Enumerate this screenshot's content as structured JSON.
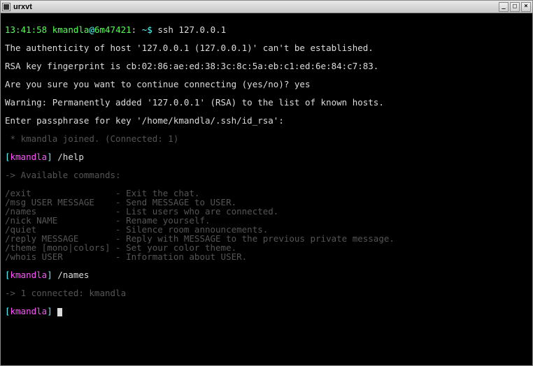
{
  "window": {
    "title": "urxvt"
  },
  "shell": {
    "timestamp": "13:41:58",
    "user": "kmandla",
    "host": "6m47421",
    "path": "~",
    "prompt_symbol": "$",
    "command": "ssh 127.0.0.1"
  },
  "ssh": {
    "auth_line": "The authenticity of host '127.0.0.1 (127.0.0.1)' can't be established.",
    "fingerprint_line": "RSA key fingerprint is cb:02:86:ae:ed:38:3c:8c:5a:eb:c1:ed:6e:84:c7:83.",
    "confirm_prompt": "Are you sure you want to continue connecting (yes/no)? yes",
    "warning_line": "Warning: Permanently added '127.0.0.1' (RSA) to the list of known hosts.",
    "passphrase_prompt": "Enter passphrase for key '/home/kmandla/.ssh/id_rsa':"
  },
  "chat": {
    "join_msg": " * kmandla joined. (Connected: 1)",
    "username": "kmandla",
    "cmd_help": "/help",
    "help_header": "-> Available commands:",
    "help_lines": [
      {
        "cmd": "/exit",
        "desc": "- Exit the chat."
      },
      {
        "cmd": "/msg USER MESSAGE",
        "desc": "- Send MESSAGE to USER."
      },
      {
        "cmd": "/names",
        "desc": "- List users who are connected."
      },
      {
        "cmd": "/nick NAME",
        "desc": "- Rename yourself."
      },
      {
        "cmd": "/quiet",
        "desc": "- Silence room announcements."
      },
      {
        "cmd": "/reply MESSAGE",
        "desc": "- Reply with MESSAGE to the previous private message."
      },
      {
        "cmd": "/theme [mono|colors]",
        "desc": "- Set your color theme."
      },
      {
        "cmd": "/whois USER",
        "desc": "- Information about USER."
      }
    ],
    "cmd_names": "/names",
    "names_output": "-> 1 connected: kmandla"
  }
}
